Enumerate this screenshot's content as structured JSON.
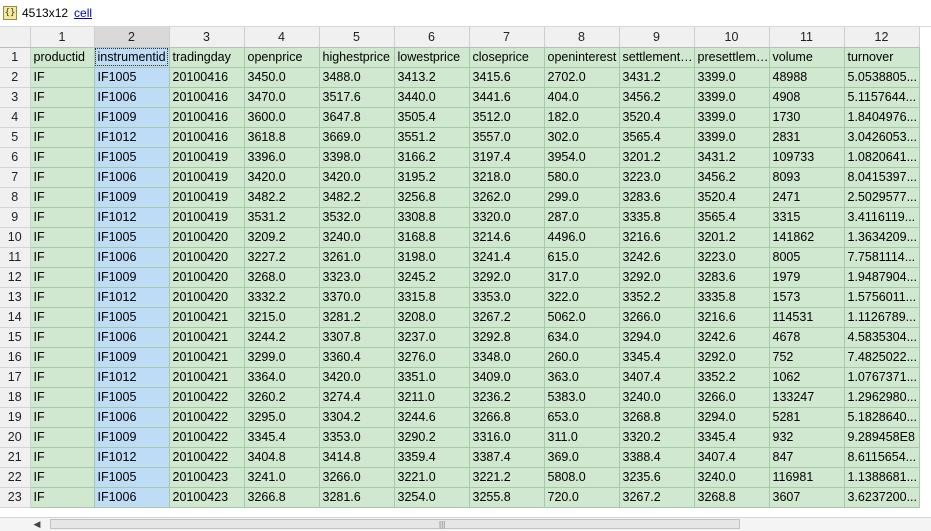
{
  "header": {
    "var_icon": "{}",
    "dimensions": "4513x12",
    "type_link": "cell"
  },
  "columns": [
    "1",
    "2",
    "3",
    "4",
    "5",
    "6",
    "7",
    "8",
    "9",
    "10",
    "11",
    "12"
  ],
  "row_numbers": [
    "1",
    "2",
    "3",
    "4",
    "5",
    "6",
    "7",
    "8",
    "9",
    "10",
    "11",
    "12",
    "13",
    "14",
    "15",
    "16",
    "17",
    "18",
    "19",
    "20",
    "21",
    "22",
    "23"
  ],
  "rows": [
    [
      "productid",
      "instrumentid",
      "tradingday",
      "openprice",
      "highestprice",
      "lowestprice",
      "closeprice",
      "openinterest",
      "settlementprice",
      "presettlementprice",
      "volume",
      "turnover"
    ],
    [
      "IF",
      "IF1005",
      "20100416",
      "3450.0",
      "3488.0",
      "3413.2",
      "3415.6",
      "2702.0",
      "3431.2",
      "3399.0",
      "48988",
      "5.0538805..."
    ],
    [
      "IF",
      "IF1006",
      "20100416",
      "3470.0",
      "3517.6",
      "3440.0",
      "3441.6",
      "404.0",
      "3456.2",
      "3399.0",
      "4908",
      "5.1157644..."
    ],
    [
      "IF",
      "IF1009",
      "20100416",
      "3600.0",
      "3647.8",
      "3505.4",
      "3512.0",
      "182.0",
      "3520.4",
      "3399.0",
      "1730",
      "1.8404976..."
    ],
    [
      "IF",
      "IF1012",
      "20100416",
      "3618.8",
      "3669.0",
      "3551.2",
      "3557.0",
      "302.0",
      "3565.4",
      "3399.0",
      "2831",
      "3.0426053..."
    ],
    [
      "IF",
      "IF1005",
      "20100419",
      "3396.0",
      "3398.0",
      "3166.2",
      "3197.4",
      "3954.0",
      "3201.2",
      "3431.2",
      "109733",
      "1.0820641..."
    ],
    [
      "IF",
      "IF1006",
      "20100419",
      "3420.0",
      "3420.0",
      "3195.2",
      "3218.0",
      "580.0",
      "3223.0",
      "3456.2",
      "8093",
      "8.0415397..."
    ],
    [
      "IF",
      "IF1009",
      "20100419",
      "3482.2",
      "3482.2",
      "3256.8",
      "3262.0",
      "299.0",
      "3283.6",
      "3520.4",
      "2471",
      "2.5029577..."
    ],
    [
      "IF",
      "IF1012",
      "20100419",
      "3531.2",
      "3532.0",
      "3308.8",
      "3320.0",
      "287.0",
      "3335.8",
      "3565.4",
      "3315",
      "3.4116119..."
    ],
    [
      "IF",
      "IF1005",
      "20100420",
      "3209.2",
      "3240.0",
      "3168.8",
      "3214.6",
      "4496.0",
      "3216.6",
      "3201.2",
      "141862",
      "1.3634209..."
    ],
    [
      "IF",
      "IF1006",
      "20100420",
      "3227.2",
      "3261.0",
      "3198.0",
      "3241.4",
      "615.0",
      "3242.6",
      "3223.0",
      "8005",
      "7.7581114..."
    ],
    [
      "IF",
      "IF1009",
      "20100420",
      "3268.0",
      "3323.0",
      "3245.2",
      "3292.0",
      "317.0",
      "3292.0",
      "3283.6",
      "1979",
      "1.9487904..."
    ],
    [
      "IF",
      "IF1012",
      "20100420",
      "3332.2",
      "3370.0",
      "3315.8",
      "3353.0",
      "322.0",
      "3352.2",
      "3335.8",
      "1573",
      "1.5756011..."
    ],
    [
      "IF",
      "IF1005",
      "20100421",
      "3215.0",
      "3281.2",
      "3208.0",
      "3267.2",
      "5062.0",
      "3266.0",
      "3216.6",
      "114531",
      "1.1126789..."
    ],
    [
      "IF",
      "IF1006",
      "20100421",
      "3244.2",
      "3307.8",
      "3237.0",
      "3292.8",
      "634.0",
      "3294.0",
      "3242.6",
      "4678",
      "4.5835304..."
    ],
    [
      "IF",
      "IF1009",
      "20100421",
      "3299.0",
      "3360.4",
      "3276.0",
      "3348.0",
      "260.0",
      "3345.4",
      "3292.0",
      "752",
      "7.4825022..."
    ],
    [
      "IF",
      "IF1012",
      "20100421",
      "3364.0",
      "3420.0",
      "3351.0",
      "3409.0",
      "363.0",
      "3407.4",
      "3352.2",
      "1062",
      "1.0767371..."
    ],
    [
      "IF",
      "IF1005",
      "20100422",
      "3260.2",
      "3274.4",
      "3211.0",
      "3236.2",
      "5383.0",
      "3240.0",
      "3266.0",
      "133247",
      "1.2962980..."
    ],
    [
      "IF",
      "IF1006",
      "20100422",
      "3295.0",
      "3304.2",
      "3244.6",
      "3266.8",
      "653.0",
      "3268.8",
      "3294.0",
      "5281",
      "5.1828640..."
    ],
    [
      "IF",
      "IF1009",
      "20100422",
      "3345.4",
      "3353.0",
      "3290.2",
      "3316.0",
      "311.0",
      "3320.2",
      "3345.4",
      "932",
      "9.289458E8"
    ],
    [
      "IF",
      "IF1012",
      "20100422",
      "3404.8",
      "3414.8",
      "3359.4",
      "3387.4",
      "369.0",
      "3388.4",
      "3407.4",
      "847",
      "8.6115654..."
    ],
    [
      "IF",
      "IF1005",
      "20100423",
      "3241.0",
      "3266.0",
      "3221.0",
      "3221.2",
      "5808.0",
      "3235.6",
      "3240.0",
      "116981",
      "1.1388681..."
    ],
    [
      "IF",
      "IF1006",
      "20100423",
      "3266.8",
      "3281.6",
      "3254.0",
      "3255.8",
      "720.0",
      "3267.2",
      "3268.8",
      "3607",
      "3.6237200..."
    ]
  ]
}
